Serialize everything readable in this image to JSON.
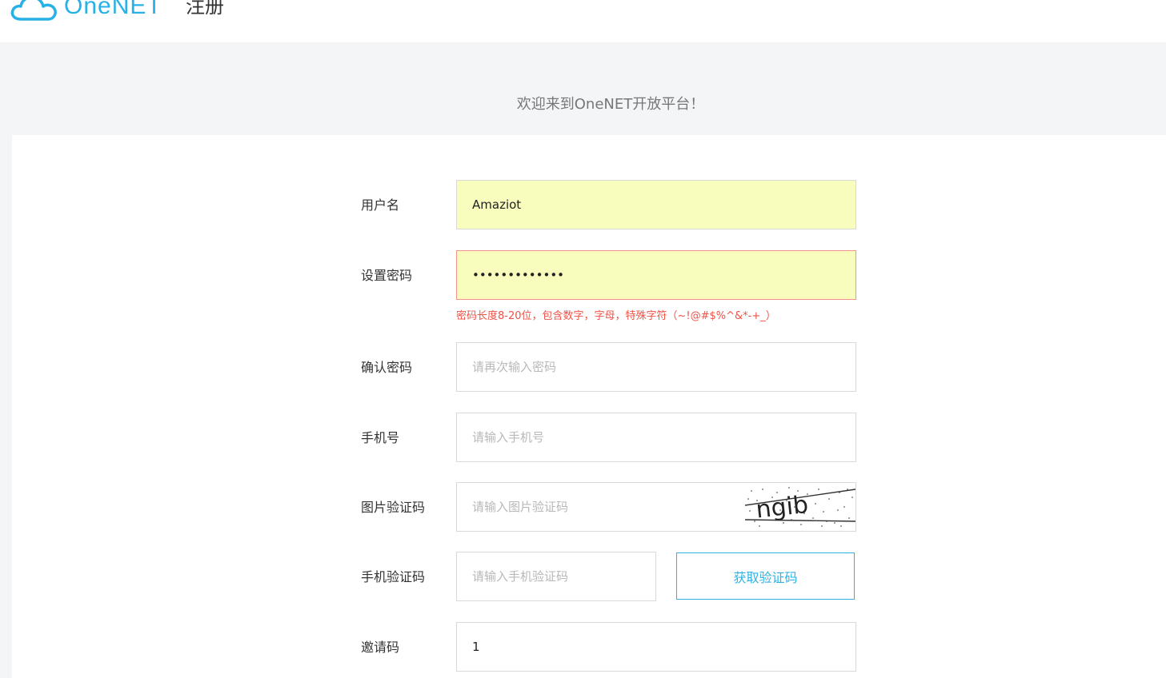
{
  "header": {
    "logo_text": "OneNET",
    "page_title": "注册",
    "brand_color": "#27b1e6"
  },
  "welcome_text": "欢迎来到OneNET开放平台！",
  "form": {
    "username": {
      "label": "用户名",
      "value": "Amaziot",
      "placeholder": ""
    },
    "password": {
      "label": "设置密码",
      "value": "•••••••••••••",
      "error": "密码长度8-20位，包含数字，字母，特殊字符（~!@#$%^&*-+_）"
    },
    "confirm_password": {
      "label": "确认密码",
      "value": "",
      "placeholder": "请再次输入密码"
    },
    "phone": {
      "label": "手机号",
      "value": "",
      "placeholder": "请输入手机号"
    },
    "image_captcha": {
      "label": "图片验证码",
      "value": "",
      "placeholder": "请输入图片验证码",
      "captcha_text": "ngib"
    },
    "sms_code": {
      "label": "手机验证码",
      "value": "",
      "placeholder": "请输入手机验证码",
      "button_label": "获取验证码"
    },
    "invite_code": {
      "label": "邀请码",
      "value": "1",
      "placeholder": ""
    }
  },
  "colors": {
    "error": "#ef5348",
    "accent": "#2fb3e2",
    "autofill": "#f8fcbd"
  }
}
